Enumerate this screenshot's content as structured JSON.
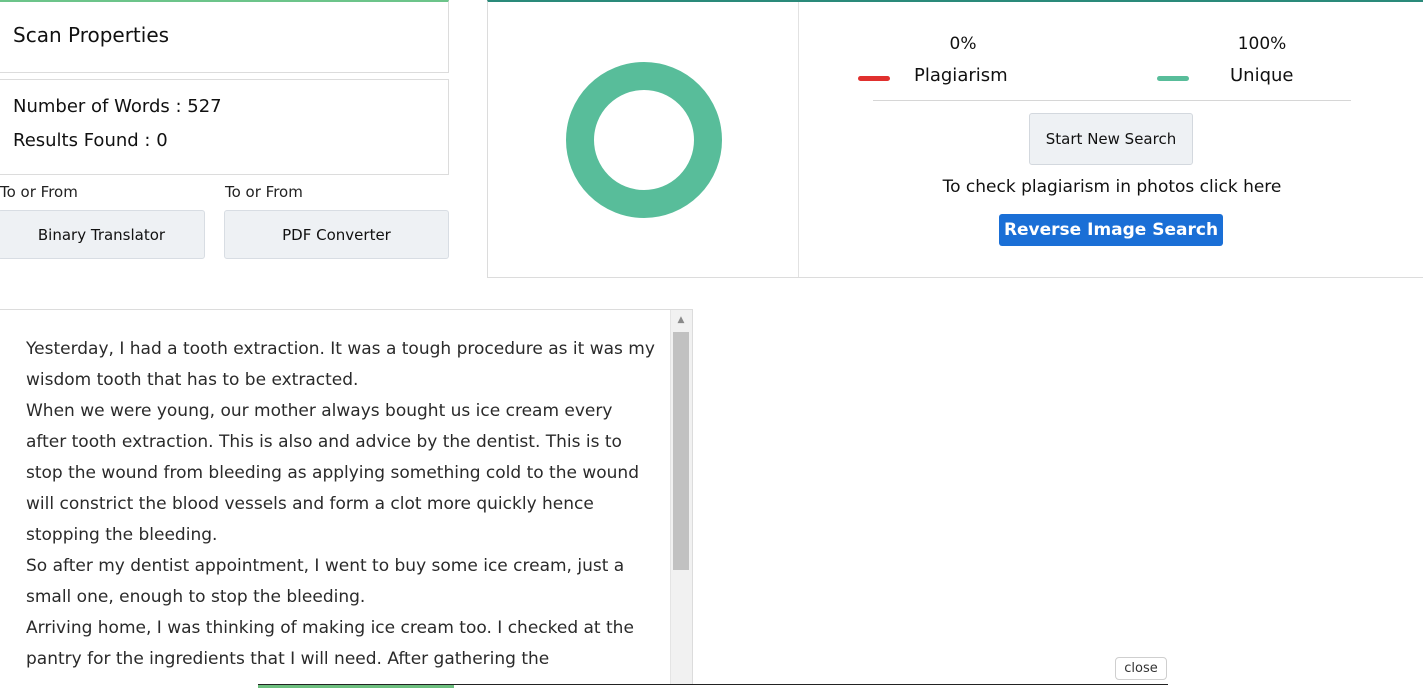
{
  "scan": {
    "title": "Scan Properties",
    "words_label": "Number of Words : 527",
    "results_label": "Results Found : 0"
  },
  "tools": [
    {
      "caption": "To or From",
      "label": "Binary Translator"
    },
    {
      "caption": "To or From",
      "label": "PDF Converter"
    }
  ],
  "result": {
    "plagiarism_pct": "0%",
    "plagiarism_label": "Plagiarism",
    "unique_pct": "100%",
    "unique_label": "Unique",
    "start_label": "Start New Search",
    "photo_hint": "To check plagiarism in photos click here",
    "reverse_label": "Reverse Image Search"
  },
  "colors": {
    "plagiarism": "#e0302e",
    "unique": "#58bd9a",
    "primary": "#1a6fd6"
  },
  "chart_data": {
    "type": "pie",
    "categories": [
      "Plagiarism",
      "Unique"
    ],
    "values": [
      0,
      100
    ],
    "colors": [
      "#e0302e",
      "#58bd9a"
    ]
  },
  "document_text": [
    "Yesterday, I had a tooth extraction. It was a tough procedure as it was my wisdom tooth that has to be extracted.",
    "When we were young, our mother always bought us ice cream every after tooth extraction. This is also and advice by the dentist. This is to stop the wound from bleeding as applying something cold to the wound will constrict the blood vessels and form a clot more quickly hence stopping the bleeding.",
    "So after my dentist appointment, I went to buy some ice cream, just a small one, enough to stop the bleeding.",
    "Arriving home, I was thinking of making ice cream too. I checked at the pantry for the ingredients that I will need. After gathering the"
  ],
  "overlay": {
    "close_label": "close"
  }
}
